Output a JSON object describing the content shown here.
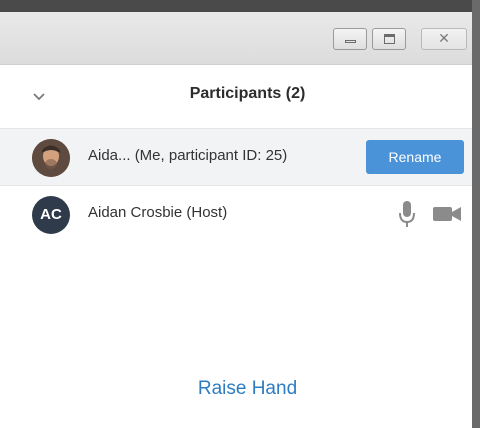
{
  "window": {
    "minimize_icon": "minimize-icon",
    "maximize_icon": "maximize-icon",
    "close_icon": "close-icon",
    "close_glyph": "✕"
  },
  "header": {
    "collapse_icon": "chevron-down-icon",
    "title": "Participants (2)"
  },
  "participants": [
    {
      "name": "Aida... (Me, participant ID: 25)",
      "avatar": "photo-avatar",
      "action_label": "Rename"
    },
    {
      "name": "Aidan Crosbie (Host)",
      "avatar_initials": "AC",
      "mic_icon": "microphone-icon",
      "video_icon": "video-camera-icon"
    }
  ],
  "footer": {
    "raise_hand_label": "Raise Hand"
  },
  "colors": {
    "accent": "#4a93d8",
    "link": "#2d7cc2",
    "avatar_bg": "#2f3b4b"
  }
}
